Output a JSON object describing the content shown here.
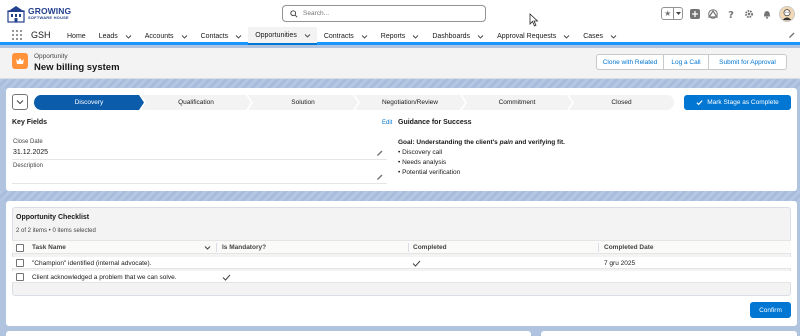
{
  "header": {
    "logo_line1": "GROWING",
    "logo_line2": "SOFTWARE HOUSE",
    "search_placeholder": "Search..."
  },
  "nav": {
    "app_name": "GSH",
    "items": [
      {
        "label": "Home",
        "has_menu": false
      },
      {
        "label": "Leads",
        "has_menu": true
      },
      {
        "label": "Accounts",
        "has_menu": true
      },
      {
        "label": "Contacts",
        "has_menu": true
      },
      {
        "label": "Opportunities",
        "has_menu": true,
        "active": true
      },
      {
        "label": "Contracts",
        "has_menu": true
      },
      {
        "label": "Reports",
        "has_menu": true
      },
      {
        "label": "Dashboards",
        "has_menu": true
      },
      {
        "label": "Approval Requests",
        "has_menu": true
      },
      {
        "label": "Cases",
        "has_menu": true
      }
    ]
  },
  "record": {
    "object_type": "Opportunity",
    "name": "New billing system",
    "actions": [
      "Clone with Related",
      "Log a Call",
      "Submit for Approval"
    ]
  },
  "path": {
    "stages": [
      "Discovery",
      "Qualification",
      "Solution",
      "Negotiation/Review",
      "Commitment",
      "Closed"
    ],
    "current_stage": "Discovery",
    "mark_button": "Mark Stage as Complete"
  },
  "key_fields": {
    "title": "Key Fields",
    "edit": "Edit",
    "close_date_label": "Close Date",
    "close_date_value": "31.12.2025",
    "description_label": "Description",
    "description_value": ""
  },
  "guidance": {
    "title": "Guidance for Success",
    "goal_prefix": "Goal: Understanding the client's ",
    "goal_em": "pain",
    "goal_suffix": " and verifying fit.",
    "bullets": [
      "• Discovery call",
      "• Needs analysis",
      "• Potential verification"
    ]
  },
  "checklist": {
    "title": "Opportunity Checklist",
    "subtitle": "2 of 2 items • 0 items selected",
    "columns": [
      "Task Name",
      "Is Mandatory?",
      "Completed",
      "Completed Date"
    ],
    "rows": [
      {
        "task": "\"Champion\" identified (internal advocate).",
        "mandatory": false,
        "completed": true,
        "date": "7 gru 2025"
      },
      {
        "task": "Client acknowledged a problem that we can solve.",
        "mandatory": true,
        "completed": false,
        "date": ""
      }
    ],
    "confirm": "Confirm"
  },
  "colors": {
    "brand_blue": "#0176d3",
    "path_current": "#0b5cab",
    "path_incomplete": "#f3f3f3",
    "object_icon": "#fe9339"
  }
}
